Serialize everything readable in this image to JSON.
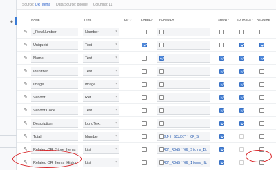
{
  "infobar": {
    "source_label": "Source:",
    "source_value": "QR_Items",
    "datasource_label": "Data Source:",
    "datasource_value": "google",
    "columns_label": "Columns:",
    "columns_value": "11"
  },
  "headers": {
    "name": "NAME",
    "type": "TYPE",
    "key": "KEY?",
    "label": "LABEL?",
    "formula": "FORMULA",
    "show": "SHOW?",
    "editable": "EDITABLE?",
    "require": "REQUIRE"
  },
  "rows": [
    {
      "name": "_RowNumber",
      "type": "Number",
      "formula": "",
      "key": false,
      "label": false,
      "show": false,
      "editable": false,
      "require": false
    },
    {
      "name": "Uniqueid",
      "type": "Text",
      "formula": "=",
      "key": true,
      "label": false,
      "show": false,
      "editable": true,
      "require": true
    },
    {
      "name": "Name",
      "type": "Text",
      "formula": "=",
      "key": false,
      "label": true,
      "show": true,
      "editable": true,
      "require": true
    },
    {
      "name": "Identifier",
      "type": "Text",
      "formula": "=",
      "key": false,
      "label": false,
      "show": true,
      "editable": true,
      "require": false
    },
    {
      "name": "Image",
      "type": "Image",
      "formula": "=",
      "key": false,
      "label": false,
      "show": true,
      "editable": true,
      "require": false
    },
    {
      "name": "Vendor",
      "type": "Ref",
      "formula": "=",
      "key": false,
      "label": false,
      "show": true,
      "editable": true,
      "require": false
    },
    {
      "name": "Vendor Code",
      "type": "Text",
      "formula": "=",
      "key": false,
      "label": false,
      "show": true,
      "editable": true,
      "require": false
    },
    {
      "name": "Description",
      "type": "LongText",
      "formula": "=",
      "key": false,
      "label": false,
      "show": true,
      "editable": true,
      "require": false
    },
    {
      "name": "Total",
      "type": "Number",
      "formula": "= SUM(  SELECT(    QR_S",
      "key": false,
      "label": false,
      "show": true,
      "editable": false,
      "require": false
    },
    {
      "name": "Related QR_Store_Items",
      "type": "List",
      "formula": "= REF_ROWS(\"QR_Store_It",
      "key": false,
      "label": false,
      "show": true,
      "editable": false,
      "require": false
    },
    {
      "name": "Related QR_Items_Histor",
      "type": "List",
      "formula": "= REF_ROWS(\"QR_Items_Hi",
      "key": false,
      "label": false,
      "show": true,
      "editable": false,
      "require": false
    }
  ]
}
